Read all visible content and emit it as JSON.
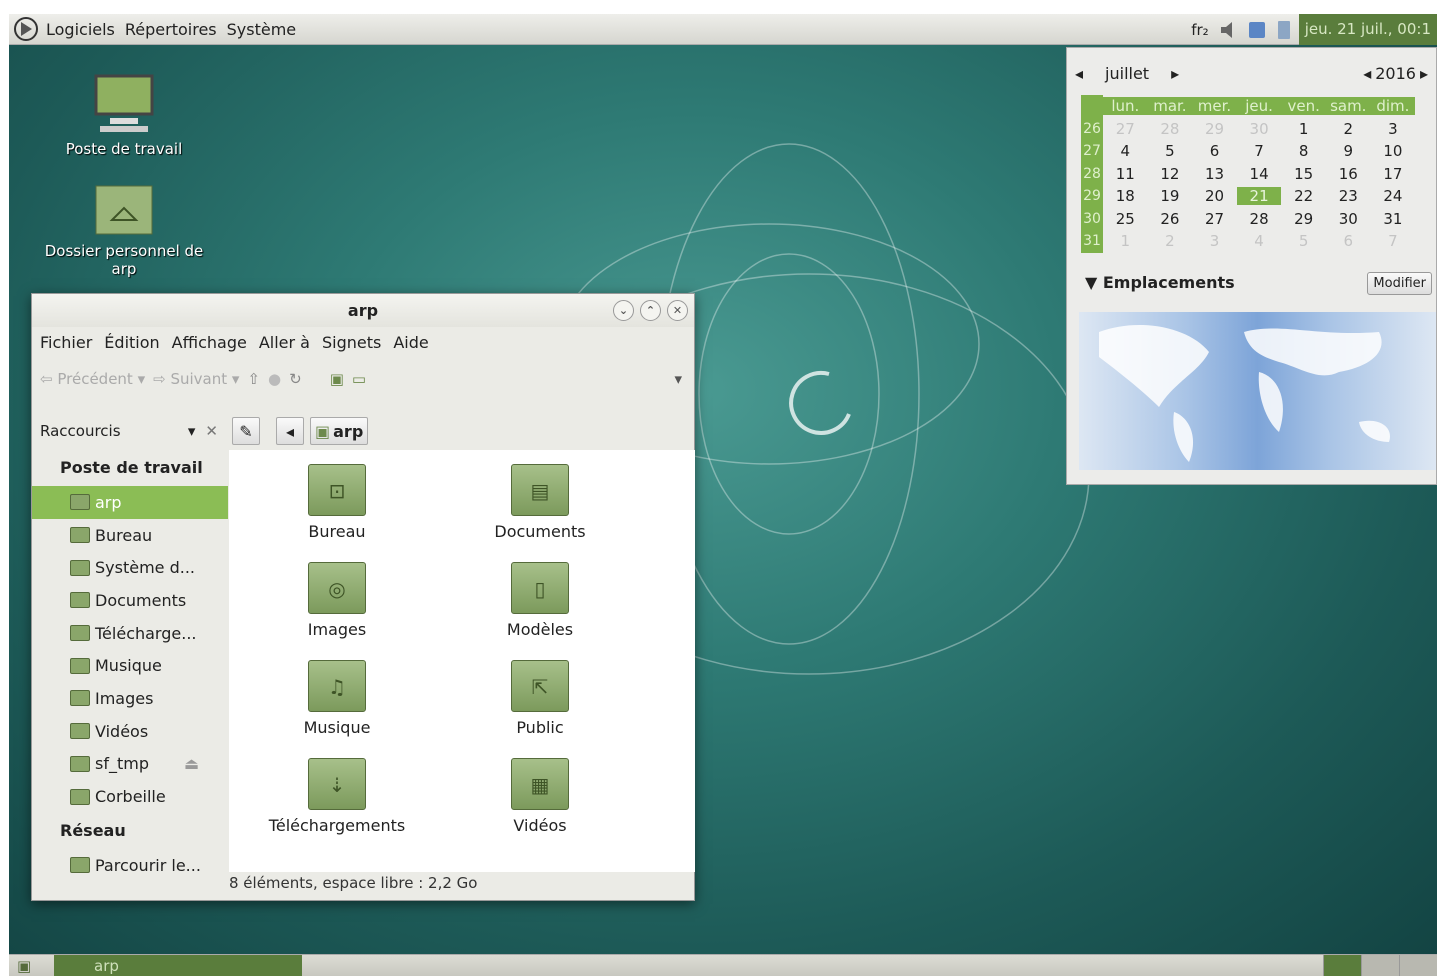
{
  "top_panel": {
    "menus": [
      "Logiciels",
      "Répertoires",
      "Système"
    ],
    "keyboard": "fr₂",
    "clock": "jeu. 21 juil., 00:1"
  },
  "desktop_icons": [
    {
      "label": "Poste de travail",
      "icon": "computer-icon"
    },
    {
      "label": "Dossier personnel de arp",
      "icon": "home-folder-icon"
    }
  ],
  "calendar": {
    "month": "juillet",
    "year": "2016",
    "day_names": [
      "lun.",
      "mar.",
      "mer.",
      "jeu.",
      "ven.",
      "sam.",
      "dim."
    ],
    "weeks": [
      {
        "num": "26",
        "days": [
          [
            "27",
            1
          ],
          [
            "28",
            1
          ],
          [
            "29",
            1
          ],
          [
            "30",
            1
          ],
          [
            "1",
            0
          ],
          [
            "2",
            0
          ],
          [
            "3",
            0
          ]
        ]
      },
      {
        "num": "27",
        "days": [
          [
            "4",
            0
          ],
          [
            "5",
            0
          ],
          [
            "6",
            0
          ],
          [
            "7",
            0
          ],
          [
            "8",
            0
          ],
          [
            "9",
            0
          ],
          [
            "10",
            0
          ]
        ]
      },
      {
        "num": "28",
        "days": [
          [
            "11",
            0
          ],
          [
            "12",
            0
          ],
          [
            "13",
            0
          ],
          [
            "14",
            0
          ],
          [
            "15",
            0
          ],
          [
            "16",
            0
          ],
          [
            "17",
            0
          ]
        ]
      },
      {
        "num": "29",
        "days": [
          [
            "18",
            0
          ],
          [
            "19",
            0
          ],
          [
            "20",
            0
          ],
          [
            "21",
            2
          ],
          [
            "22",
            0
          ],
          [
            "23",
            0
          ],
          [
            "24",
            0
          ]
        ]
      },
      {
        "num": "30",
        "days": [
          [
            "25",
            0
          ],
          [
            "26",
            0
          ],
          [
            "27",
            0
          ],
          [
            "28",
            0
          ],
          [
            "29",
            0
          ],
          [
            "30",
            0
          ],
          [
            "31",
            0
          ]
        ]
      },
      {
        "num": "31",
        "days": [
          [
            "1",
            1
          ],
          [
            "2",
            1
          ],
          [
            "3",
            1
          ],
          [
            "4",
            1
          ],
          [
            "5",
            1
          ],
          [
            "6",
            1
          ],
          [
            "7",
            1
          ]
        ]
      }
    ],
    "locations_label": "Emplacements",
    "modify_label": "Modifier"
  },
  "window": {
    "title": "arp",
    "menus": [
      "Fichier",
      "Édition",
      "Affichage",
      "Aller à",
      "Signets",
      "Aide"
    ],
    "toolbar": {
      "back": "Précédent",
      "forward": "Suivant"
    },
    "side_header": "Raccourcis",
    "path_button": "arp",
    "sidebar": {
      "section1": "Poste de travail",
      "items1": [
        "arp",
        "Bureau",
        "Système d...",
        "Documents",
        "Télécharge...",
        "Musique",
        "Images",
        "Vidéos",
        "sf_tmp",
        "Corbeille"
      ],
      "section2": "Réseau",
      "items2": [
        "Parcourir le..."
      ]
    },
    "files": [
      {
        "name": "Bureau",
        "glyph": "⊡"
      },
      {
        "name": "Documents",
        "glyph": "▤"
      },
      {
        "name": "Images",
        "glyph": "◎"
      },
      {
        "name": "Modèles",
        "glyph": "▯"
      },
      {
        "name": "Musique",
        "glyph": "♫"
      },
      {
        "name": "Public",
        "glyph": "⇱"
      },
      {
        "name": "Téléchargements",
        "glyph": "⇣"
      },
      {
        "name": "Vidéos",
        "glyph": "▦"
      }
    ],
    "status": "8 éléments, espace libre : 2,2 Go"
  },
  "bottom_panel": {
    "task": "arp"
  }
}
